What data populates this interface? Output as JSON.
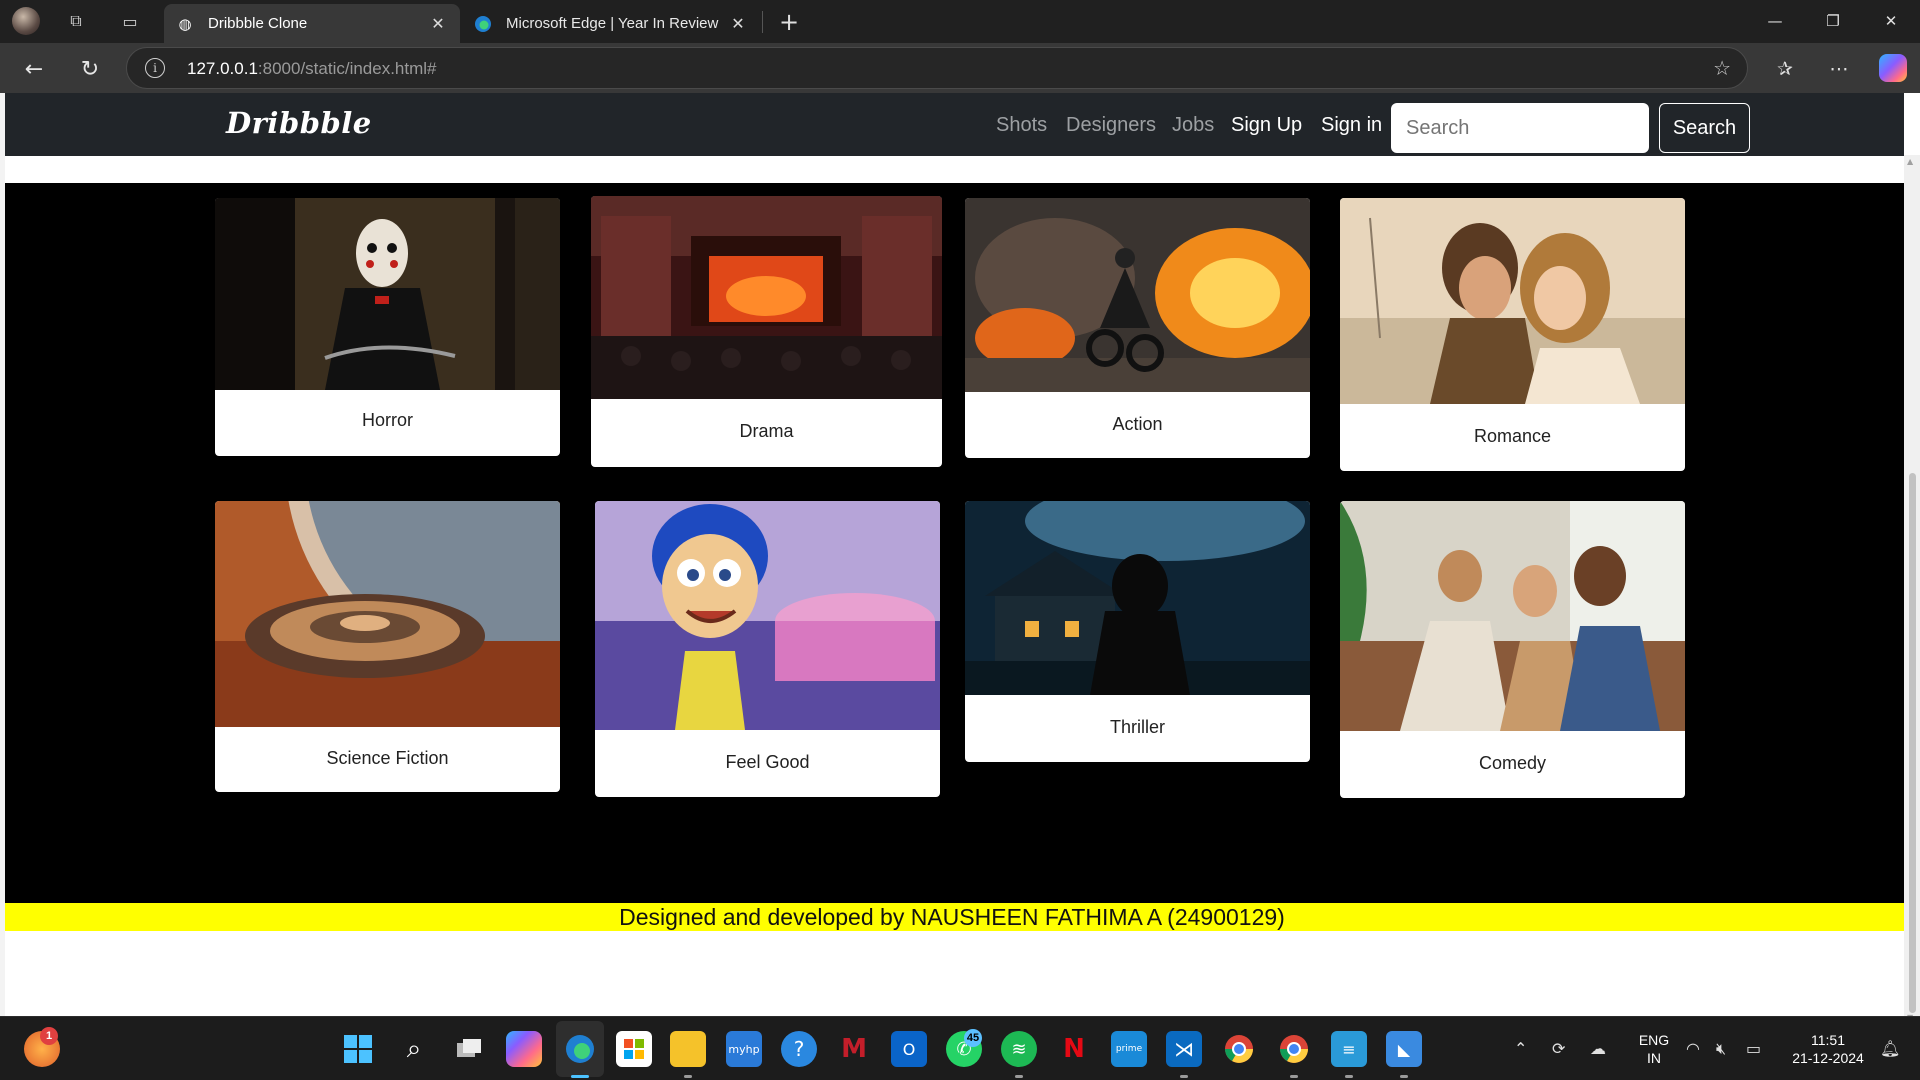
{
  "browser": {
    "tabs": [
      {
        "label": "Dribbble Clone",
        "active": true
      },
      {
        "label": "Microsoft Edge | Year In Review",
        "active": false
      }
    ],
    "url_host": "127.0.0.1",
    "url_rest": ":8000/static/index.html#",
    "window_controls": {
      "minimize": "—",
      "restore": "❐",
      "close": "✕"
    }
  },
  "site": {
    "logo": "Dribbble",
    "nav": [
      "Shots",
      "Designers",
      "Jobs",
      "Sign Up",
      "Sign in"
    ],
    "search_placeholder": "Search",
    "search_button": "Search"
  },
  "genres": [
    {
      "label": "Horror",
      "image": "doll-puppet-photo"
    },
    {
      "label": "Drama",
      "image": "theater-stage-photo"
    },
    {
      "label": "Action",
      "image": "motorcycle-explosion-photo"
    },
    {
      "label": "Romance",
      "image": "couple-embrace-photo"
    },
    {
      "label": "Science Fiction",
      "image": "spaceship-planet-photo"
    },
    {
      "label": "Feel Good",
      "image": "animated-character-photo"
    },
    {
      "label": "Thriller",
      "image": "hooded-figure-house-photo"
    },
    {
      "label": "Comedy",
      "image": "friends-laughing-photo"
    }
  ],
  "footer": "Designed and developed by NAUSHEEN FATHIMA A (24900129)",
  "taskbar": {
    "notification_count": "1",
    "whatsapp_badge": "45",
    "lang_line1": "ENG",
    "lang_line2": "IN",
    "time": "11:51",
    "date": "21-12-2024"
  }
}
